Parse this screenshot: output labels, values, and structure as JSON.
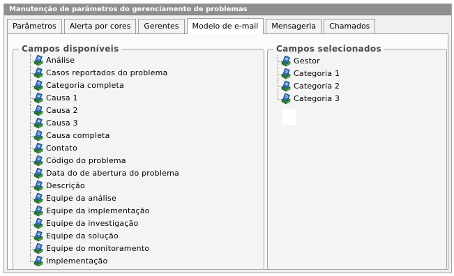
{
  "window": {
    "title": "Manutenção de parâmetros do gerenciamento de problemas"
  },
  "tabs": [
    {
      "label": "Parâmetros"
    },
    {
      "label": "Alerta por cores"
    },
    {
      "label": "Gerentes"
    },
    {
      "label": "Modelo de e-mail",
      "active": true
    },
    {
      "label": "Mensageria"
    },
    {
      "label": "Chamados"
    }
  ],
  "available": {
    "legend": "Campos disponíveis",
    "items": [
      "Análise",
      "Casos reportados do problema",
      "Categoria completa",
      "Causa 1",
      "Causa 2",
      "Causa 3",
      "Causa completa",
      "Contato",
      "Código do problema",
      "Data do de abertura do problema",
      "Descrição",
      "Equipe da análise",
      "Equipe da implementação",
      "Equipe da investigação",
      "Equipe da solução",
      "Equipe do monitoramento",
      "Implementação"
    ]
  },
  "selected": {
    "legend": "Campos selecionados",
    "items": [
      "Gestor",
      "Categoria 1",
      "Categoria 2",
      "Categoria 3"
    ]
  },
  "icons": {
    "field": "field-item-icon"
  },
  "colors": {
    "titlebar": "#8f8f8f",
    "border": "#9c9c9c",
    "icon_blue": "#2f6fc0",
    "icon_green": "#3c9a3c"
  }
}
